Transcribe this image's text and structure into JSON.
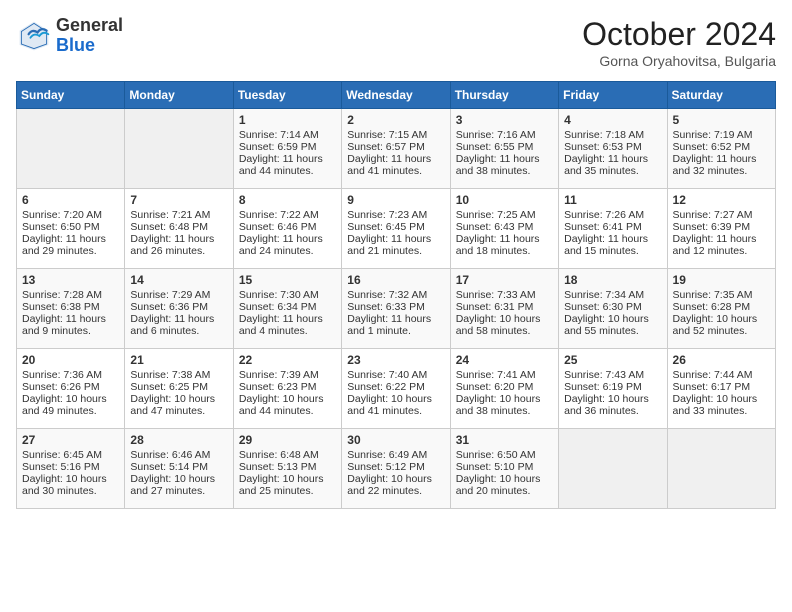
{
  "header": {
    "logo_general": "General",
    "logo_blue": "Blue",
    "month_year": "October 2024",
    "location": "Gorna Oryahovitsa, Bulgaria"
  },
  "days_of_week": [
    "Sunday",
    "Monday",
    "Tuesday",
    "Wednesday",
    "Thursday",
    "Friday",
    "Saturday"
  ],
  "weeks": [
    [
      {
        "day": "",
        "sunrise": "",
        "sunset": "",
        "daylight": ""
      },
      {
        "day": "",
        "sunrise": "",
        "sunset": "",
        "daylight": ""
      },
      {
        "day": "1",
        "sunrise": "Sunrise: 7:14 AM",
        "sunset": "Sunset: 6:59 PM",
        "daylight": "Daylight: 11 hours and 44 minutes."
      },
      {
        "day": "2",
        "sunrise": "Sunrise: 7:15 AM",
        "sunset": "Sunset: 6:57 PM",
        "daylight": "Daylight: 11 hours and 41 minutes."
      },
      {
        "day": "3",
        "sunrise": "Sunrise: 7:16 AM",
        "sunset": "Sunset: 6:55 PM",
        "daylight": "Daylight: 11 hours and 38 minutes."
      },
      {
        "day": "4",
        "sunrise": "Sunrise: 7:18 AM",
        "sunset": "Sunset: 6:53 PM",
        "daylight": "Daylight: 11 hours and 35 minutes."
      },
      {
        "day": "5",
        "sunrise": "Sunrise: 7:19 AM",
        "sunset": "Sunset: 6:52 PM",
        "daylight": "Daylight: 11 hours and 32 minutes."
      }
    ],
    [
      {
        "day": "6",
        "sunrise": "Sunrise: 7:20 AM",
        "sunset": "Sunset: 6:50 PM",
        "daylight": "Daylight: 11 hours and 29 minutes."
      },
      {
        "day": "7",
        "sunrise": "Sunrise: 7:21 AM",
        "sunset": "Sunset: 6:48 PM",
        "daylight": "Daylight: 11 hours and 26 minutes."
      },
      {
        "day": "8",
        "sunrise": "Sunrise: 7:22 AM",
        "sunset": "Sunset: 6:46 PM",
        "daylight": "Daylight: 11 hours and 24 minutes."
      },
      {
        "day": "9",
        "sunrise": "Sunrise: 7:23 AM",
        "sunset": "Sunset: 6:45 PM",
        "daylight": "Daylight: 11 hours and 21 minutes."
      },
      {
        "day": "10",
        "sunrise": "Sunrise: 7:25 AM",
        "sunset": "Sunset: 6:43 PM",
        "daylight": "Daylight: 11 hours and 18 minutes."
      },
      {
        "day": "11",
        "sunrise": "Sunrise: 7:26 AM",
        "sunset": "Sunset: 6:41 PM",
        "daylight": "Daylight: 11 hours and 15 minutes."
      },
      {
        "day": "12",
        "sunrise": "Sunrise: 7:27 AM",
        "sunset": "Sunset: 6:39 PM",
        "daylight": "Daylight: 11 hours and 12 minutes."
      }
    ],
    [
      {
        "day": "13",
        "sunrise": "Sunrise: 7:28 AM",
        "sunset": "Sunset: 6:38 PM",
        "daylight": "Daylight: 11 hours and 9 minutes."
      },
      {
        "day": "14",
        "sunrise": "Sunrise: 7:29 AM",
        "sunset": "Sunset: 6:36 PM",
        "daylight": "Daylight: 11 hours and 6 minutes."
      },
      {
        "day": "15",
        "sunrise": "Sunrise: 7:30 AM",
        "sunset": "Sunset: 6:34 PM",
        "daylight": "Daylight: 11 hours and 4 minutes."
      },
      {
        "day": "16",
        "sunrise": "Sunrise: 7:32 AM",
        "sunset": "Sunset: 6:33 PM",
        "daylight": "Daylight: 11 hours and 1 minute."
      },
      {
        "day": "17",
        "sunrise": "Sunrise: 7:33 AM",
        "sunset": "Sunset: 6:31 PM",
        "daylight": "Daylight: 10 hours and 58 minutes."
      },
      {
        "day": "18",
        "sunrise": "Sunrise: 7:34 AM",
        "sunset": "Sunset: 6:30 PM",
        "daylight": "Daylight: 10 hours and 55 minutes."
      },
      {
        "day": "19",
        "sunrise": "Sunrise: 7:35 AM",
        "sunset": "Sunset: 6:28 PM",
        "daylight": "Daylight: 10 hours and 52 minutes."
      }
    ],
    [
      {
        "day": "20",
        "sunrise": "Sunrise: 7:36 AM",
        "sunset": "Sunset: 6:26 PM",
        "daylight": "Daylight: 10 hours and 49 minutes."
      },
      {
        "day": "21",
        "sunrise": "Sunrise: 7:38 AM",
        "sunset": "Sunset: 6:25 PM",
        "daylight": "Daylight: 10 hours and 47 minutes."
      },
      {
        "day": "22",
        "sunrise": "Sunrise: 7:39 AM",
        "sunset": "Sunset: 6:23 PM",
        "daylight": "Daylight: 10 hours and 44 minutes."
      },
      {
        "day": "23",
        "sunrise": "Sunrise: 7:40 AM",
        "sunset": "Sunset: 6:22 PM",
        "daylight": "Daylight: 10 hours and 41 minutes."
      },
      {
        "day": "24",
        "sunrise": "Sunrise: 7:41 AM",
        "sunset": "Sunset: 6:20 PM",
        "daylight": "Daylight: 10 hours and 38 minutes."
      },
      {
        "day": "25",
        "sunrise": "Sunrise: 7:43 AM",
        "sunset": "Sunset: 6:19 PM",
        "daylight": "Daylight: 10 hours and 36 minutes."
      },
      {
        "day": "26",
        "sunrise": "Sunrise: 7:44 AM",
        "sunset": "Sunset: 6:17 PM",
        "daylight": "Daylight: 10 hours and 33 minutes."
      }
    ],
    [
      {
        "day": "27",
        "sunrise": "Sunrise: 6:45 AM",
        "sunset": "Sunset: 5:16 PM",
        "daylight": "Daylight: 10 hours and 30 minutes."
      },
      {
        "day": "28",
        "sunrise": "Sunrise: 6:46 AM",
        "sunset": "Sunset: 5:14 PM",
        "daylight": "Daylight: 10 hours and 27 minutes."
      },
      {
        "day": "29",
        "sunrise": "Sunrise: 6:48 AM",
        "sunset": "Sunset: 5:13 PM",
        "daylight": "Daylight: 10 hours and 25 minutes."
      },
      {
        "day": "30",
        "sunrise": "Sunrise: 6:49 AM",
        "sunset": "Sunset: 5:12 PM",
        "daylight": "Daylight: 10 hours and 22 minutes."
      },
      {
        "day": "31",
        "sunrise": "Sunrise: 6:50 AM",
        "sunset": "Sunset: 5:10 PM",
        "daylight": "Daylight: 10 hours and 20 minutes."
      },
      {
        "day": "",
        "sunrise": "",
        "sunset": "",
        "daylight": ""
      },
      {
        "day": "",
        "sunrise": "",
        "sunset": "",
        "daylight": ""
      }
    ]
  ]
}
